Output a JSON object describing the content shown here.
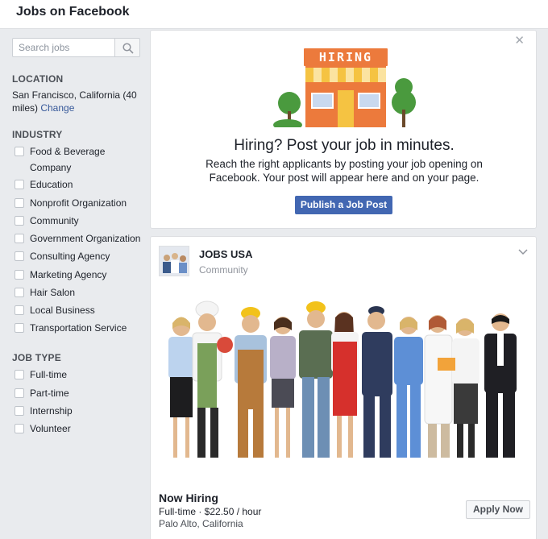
{
  "header": {
    "title": "Jobs on Facebook"
  },
  "sidebar": {
    "search": {
      "placeholder": "Search jobs",
      "value": ""
    },
    "location": {
      "heading": "LOCATION",
      "text": "San Francisco, California (40 miles)",
      "change_link": "Change"
    },
    "industry": {
      "heading": "INDUSTRY",
      "items": [
        {
          "label": "Food & Beverage Company",
          "checked": false
        },
        {
          "label": "Education",
          "checked": false
        },
        {
          "label": "Nonprofit Organization",
          "checked": false
        },
        {
          "label": "Community",
          "checked": false
        },
        {
          "label": "Government Organization",
          "checked": false
        },
        {
          "label": "Consulting Agency",
          "checked": false
        },
        {
          "label": "Marketing Agency",
          "checked": false
        },
        {
          "label": "Hair Salon",
          "checked": false
        },
        {
          "label": "Local Business",
          "checked": false
        },
        {
          "label": "Transportation Service",
          "checked": false
        }
      ]
    },
    "job_type": {
      "heading": "JOB TYPE",
      "items": [
        {
          "label": "Full-time",
          "checked": false
        },
        {
          "label": "Part-time",
          "checked": false
        },
        {
          "label": "Internship",
          "checked": false
        },
        {
          "label": "Volunteer",
          "checked": false
        }
      ]
    }
  },
  "hiring_promo": {
    "sign_text": "HIRING",
    "title": "Hiring? Post your job in minutes.",
    "description": "Reach the right applicants by posting your job opening on Facebook. Your post will appear here and on your page.",
    "button": "Publish a Job Post",
    "close_icon": "close-icon"
  },
  "job_post": {
    "page_name": "JOBS USA",
    "page_category": "Community",
    "title": "Now Hiring",
    "meta": "Full-time · $22.50 / hour",
    "location": "Palo Alto, California",
    "apply_button": "Apply Now"
  },
  "colors": {
    "brand": "#4267b2",
    "link": "#365899",
    "page_bg": "#e9ebee",
    "hiring_orange": "#ec7a3c",
    "hiring_yellow": "#f5c342",
    "tree_green": "#4a9a3e"
  }
}
